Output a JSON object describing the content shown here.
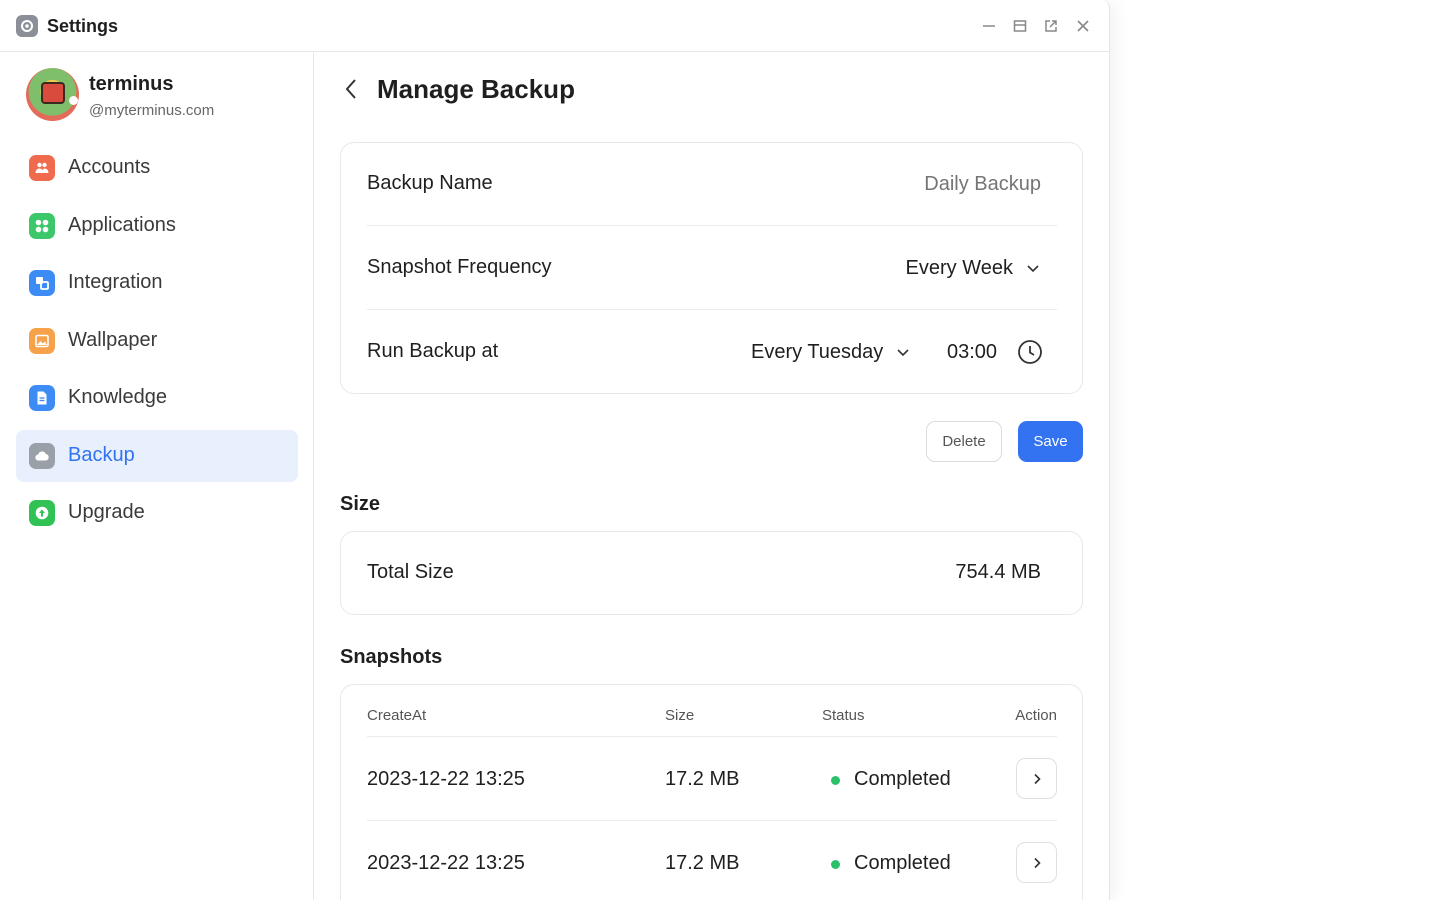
{
  "app": {
    "title": "Settings"
  },
  "profile": {
    "name": "terminus",
    "domain": "@myterminus.com"
  },
  "sidebar": {
    "items": [
      {
        "label": "Accounts",
        "icon": "accounts-icon",
        "color": "#f06a4e"
      },
      {
        "label": "Applications",
        "icon": "applications-icon",
        "color": "#3cc86a"
      },
      {
        "label": "Integration",
        "icon": "integration-icon",
        "color": "#3d8cf5"
      },
      {
        "label": "Wallpaper",
        "icon": "wallpaper-icon",
        "color": "#f5a24a"
      },
      {
        "label": "Knowledge",
        "icon": "knowledge-icon",
        "color": "#3d8cf5"
      },
      {
        "label": "Backup",
        "icon": "backup-icon",
        "color": "#9aa0a8",
        "active": true
      },
      {
        "label": "Upgrade",
        "icon": "upgrade-icon",
        "color": "#31c255"
      }
    ]
  },
  "page": {
    "title": "Manage Backup"
  },
  "form": {
    "backup_name_label": "Backup Name",
    "backup_name_placeholder": "Daily Backup",
    "frequency_label": "Snapshot Frequency",
    "frequency_value": "Every Week",
    "run_label": "Run Backup at",
    "run_day": "Every Tuesday",
    "run_time": "03:00"
  },
  "actions": {
    "delete": "Delete",
    "save": "Save"
  },
  "size": {
    "section_title": "Size",
    "label": "Total Size",
    "value": "754.4 MB"
  },
  "snapshots": {
    "section_title": "Snapshots",
    "columns": [
      "CreateAt",
      "Size",
      "Status",
      "Action"
    ],
    "rows": [
      {
        "created": "2023-12-22 13:25",
        "size": "17.2 MB",
        "status": "Completed"
      },
      {
        "created": "2023-12-22 13:25",
        "size": "17.2 MB",
        "status": "Completed"
      }
    ]
  },
  "colors": {
    "accent": "#3372f0",
    "status_completed": "#29c26a",
    "active_bg": "#e8effd"
  }
}
